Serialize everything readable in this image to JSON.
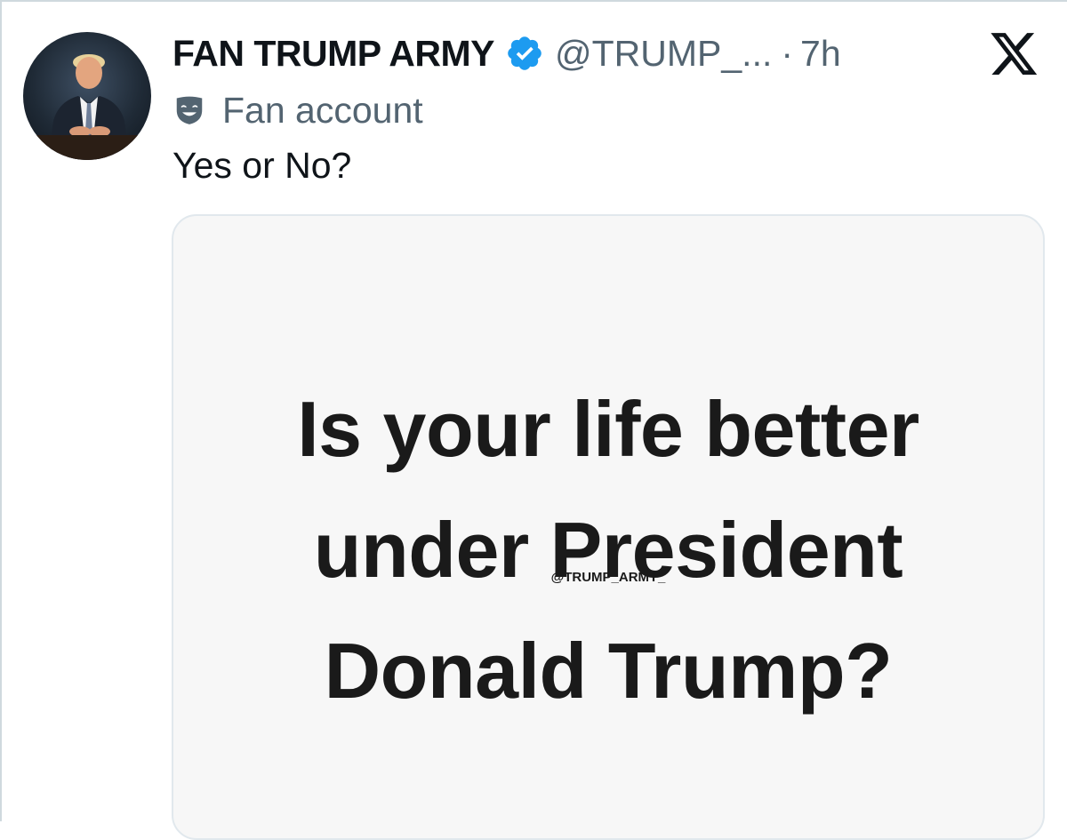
{
  "tweet": {
    "display_name": "FAN TRUMP ARMY",
    "handle": "@TRUMP_...",
    "separator": "·",
    "time_ago": "7h",
    "label": "Fan account",
    "text": "Yes or No?",
    "verified_icon": "verified-badge-icon",
    "label_icon": "theater-mask-icon",
    "platform_icon": "x-logo-icon",
    "verified_color": "#1d9bf0"
  },
  "media_card": {
    "headline_lines": [
      "Is your life better",
      "under President",
      "Donald Trump?"
    ],
    "watermark": "@TRUMP_ARMY_"
  }
}
